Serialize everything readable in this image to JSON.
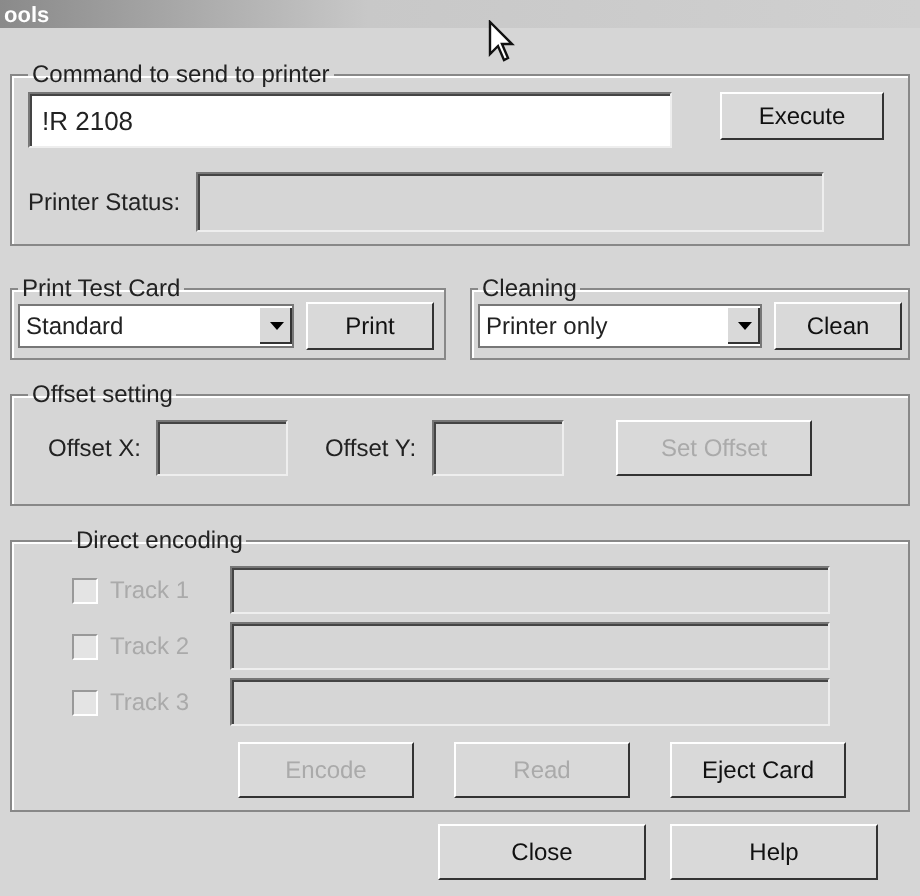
{
  "window": {
    "title": "ools"
  },
  "command": {
    "label": "Command to send to printer",
    "value": "!R 2108",
    "button": {
      "label": "Execute",
      "disabled": false
    }
  },
  "status": {
    "label": "Printer Status:"
  },
  "test_card": {
    "label": "Print Test Card",
    "value": "Standard",
    "button": {
      "label": "Print",
      "disabled": false
    }
  },
  "cleaning": {
    "label": "Cleaning",
    "value": "Printer only",
    "button": {
      "label": "Clean",
      "disabled": false
    }
  },
  "offset": {
    "label": "Offset setting",
    "x_label": "Offset X:",
    "y_label": "Offset Y:",
    "button": {
      "label": "Set Offset",
      "disabled": true
    }
  },
  "encoding": {
    "label": "Direct encoding",
    "tracks": [
      {
        "label": "Track 1",
        "checked": false,
        "disabled": true
      },
      {
        "label": "Track 2",
        "checked": false,
        "disabled": true
      },
      {
        "label": "Track 3",
        "checked": false,
        "disabled": true
      }
    ],
    "buttons": [
      {
        "label": "Encode",
        "disabled": true
      },
      {
        "label": "Read",
        "disabled": true
      },
      {
        "label": "Eject Card",
        "disabled": false
      }
    ]
  },
  "buttons": [
    {
      "label": "Close",
      "disabled": false
    },
    {
      "label": "Help",
      "disabled": false
    }
  ]
}
